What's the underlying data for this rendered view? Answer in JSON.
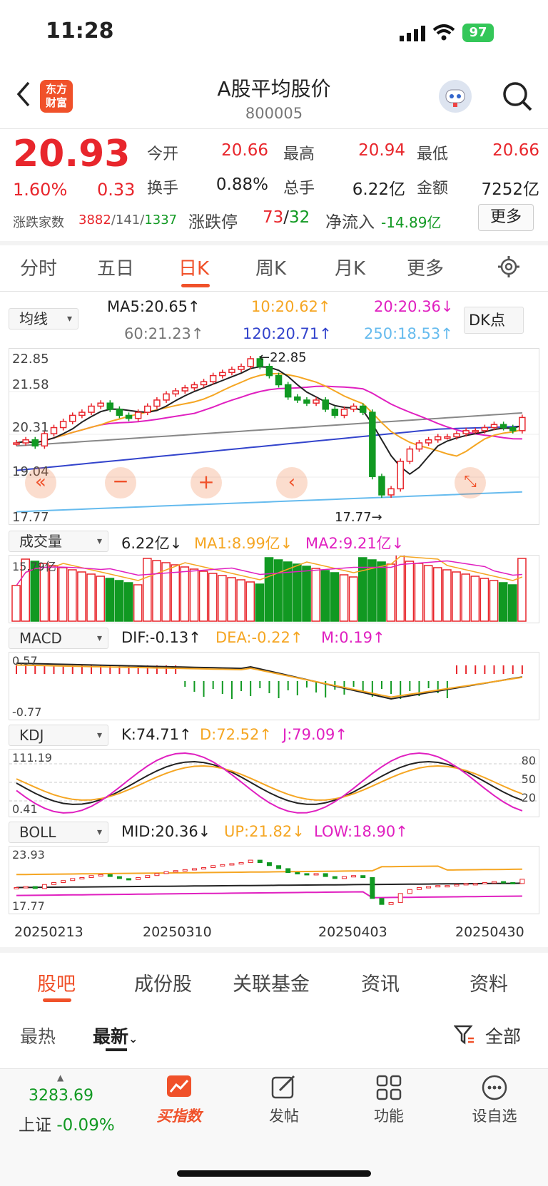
{
  "status": {
    "time": "11:28",
    "battery": "97"
  },
  "header": {
    "logo": "东方\n财富",
    "title": "A股平均股价",
    "code": "800005"
  },
  "quote": {
    "price": "20.93",
    "pct": "1.60%",
    "chg": "0.33",
    "open_l": "今开",
    "open": "20.66",
    "high_l": "最高",
    "high": "20.94",
    "low_l": "最低",
    "low": "20.66",
    "turn_l": "换手",
    "turn": "0.88%",
    "vol_l": "总手",
    "vol": "6.22亿",
    "amt_l": "金额",
    "amt": "7252亿",
    "adv_l": "涨跌家数",
    "adv_up": "3882",
    "adv_flat": "/141/",
    "adv_down": "1337",
    "limit_l": "涨跌停",
    "limit_up": "73",
    "limit_sep": "/",
    "limit_down": "32",
    "flow_l": "净流入",
    "flow": "-14.89亿",
    "more": "更多"
  },
  "tabs": [
    "分时",
    "五日",
    "日K",
    "周K",
    "月K",
    "更多"
  ],
  "ma": {
    "sel": "均线",
    "ma5": "MA5:20.65↑",
    "ma10": "10:20.62↑",
    "ma20": "20:20.36↓",
    "ma60": "60:21.23↑",
    "ma120": "120:20.71↑",
    "ma250": "250:18.53↑",
    "dk": "DK点"
  },
  "kline": {
    "t1": "22.85",
    "t2": "21.58",
    "t3": "20.31",
    "t4": "19.04",
    "t5": "17.77",
    "hi": "22.85",
    "lo": "17.77"
  },
  "vol": {
    "sel": "成交量",
    "v": "6.22亿↓",
    "ma1": "MA1:8.99亿↓",
    "ma2": "MA2:9.21亿↓",
    "top": "15.79亿"
  },
  "macd": {
    "sel": "MACD",
    "dif": "DIF:-0.13↑",
    "dea": "DEA:-0.22↑",
    "m": "M:0.19↑",
    "top": "0.57",
    "bot": "-0.77"
  },
  "kdj": {
    "sel": "KDJ",
    "k": "K:74.71↑",
    "d": "D:72.52↑",
    "j": "J:79.09↑",
    "top": "111.19",
    "bot": "0.41",
    "r80": "80",
    "r50": "50",
    "r20": "20"
  },
  "boll": {
    "sel": "BOLL",
    "mid": "MID:20.36↓",
    "up": "UP:21.82↓",
    "low": "LOW:18.90↑",
    "top": "23.93",
    "bot": "17.77"
  },
  "dates": [
    "20250213",
    "20250310",
    "20250403",
    "20250430"
  ],
  "btabs": [
    "股吧",
    "成份股",
    "关联基金",
    "资讯",
    "资料"
  ],
  "sort": {
    "hot": "最热",
    "new": "最新",
    "filter": "全部"
  },
  "nav": {
    "index_val": "3283.69",
    "index_name": "上证",
    "index_pct": "-0.09%",
    "buy": "买指数",
    "post": "发帖",
    "func": "功能",
    "watch": "设自选"
  },
  "colors": {
    "up": "#e8262c",
    "down": "#119922",
    "accent": "#f0512a",
    "ma10": "#f5a623",
    "ma20": "#e020c0",
    "ma60": "#888888",
    "ma120": "#3344cc",
    "ma250": "#66bbee"
  }
}
